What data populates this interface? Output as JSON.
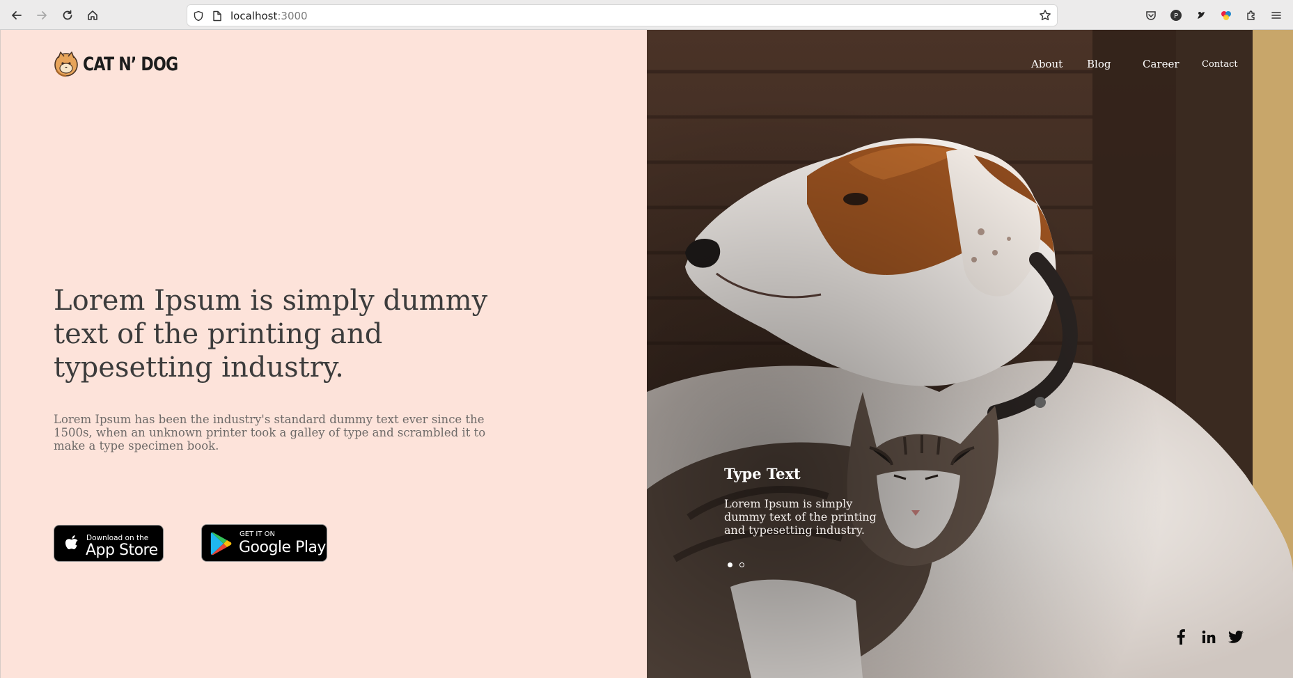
{
  "browser": {
    "url_host": "localhost",
    "url_port": ":3000"
  },
  "brand": {
    "name": "CAT N’ DOG"
  },
  "nav": {
    "items": [
      "About",
      "Blog",
      "Career",
      "Contact"
    ]
  },
  "hero": {
    "headline": "Lorem Ipsum is simply dummy text of the printing and typesetting industry.",
    "subtext": "Lorem Ipsum has been the industry's standard dummy text ever since the 1500s, when an unknown printer took a galley of type and scrambled it to make a type specimen book."
  },
  "stores": {
    "appstore_small": "Download on the",
    "appstore_big": "App Store",
    "googleplay_small": "GET IT ON",
    "googleplay_big": "Google Play"
  },
  "slide": {
    "title": "Type Text",
    "text": "Lorem Ipsum is simply dummy text of the printing and typesetting industry.",
    "total_dots": 2,
    "active_dot": 1
  },
  "social": [
    "facebook-icon",
    "linkedin-icon",
    "twitter-icon"
  ],
  "colors": {
    "left_bg": "#fde3da",
    "headline": "#3c3c3c",
    "subtext": "#6e6a68"
  }
}
